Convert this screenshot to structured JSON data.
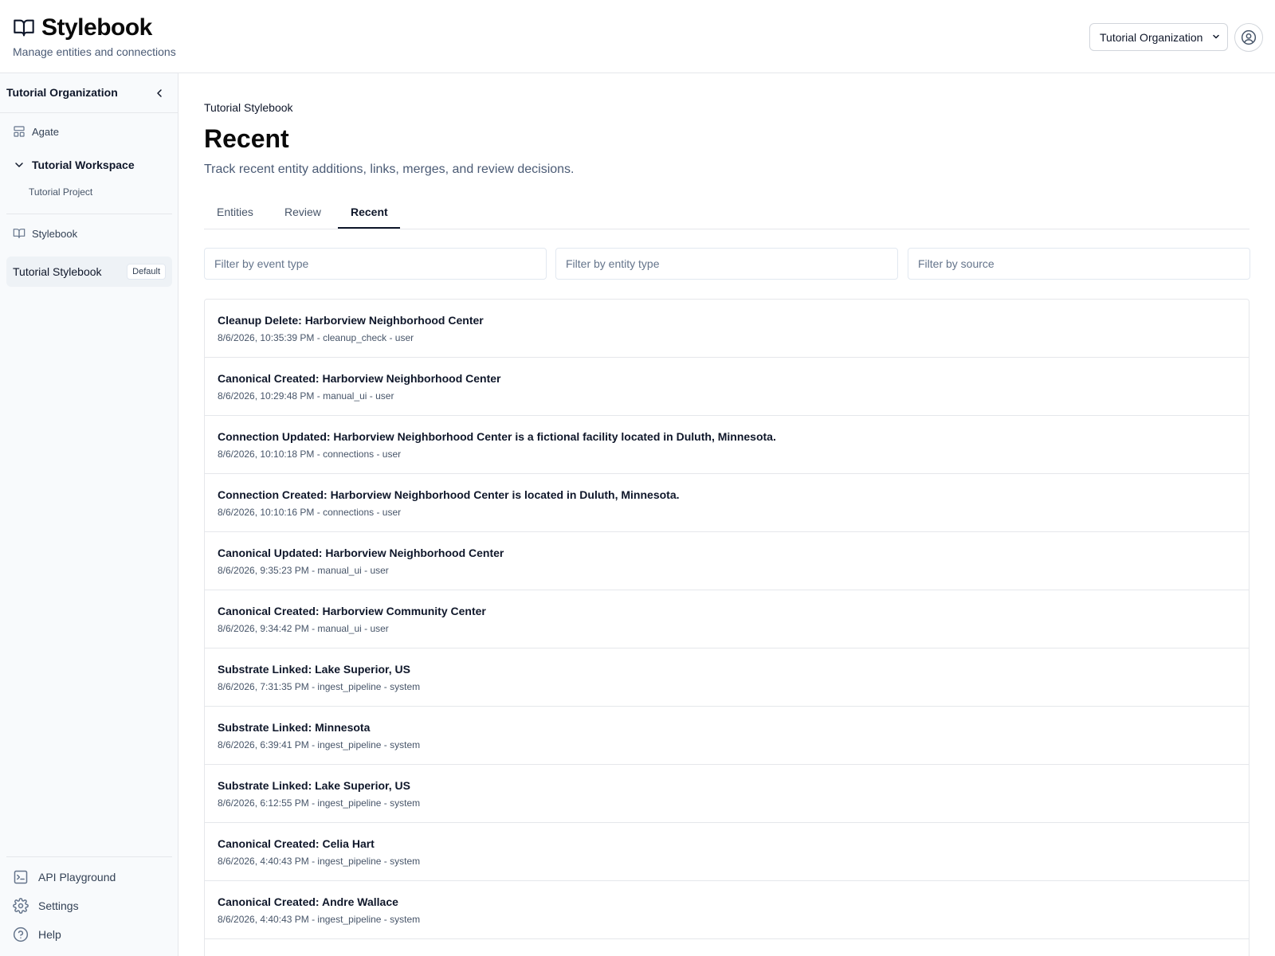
{
  "header": {
    "title": "Stylebook",
    "subtitle": "Manage entities and connections",
    "org_select": "Tutorial Organization"
  },
  "sidebar": {
    "org_name": "Tutorial Organization",
    "agate": "Agate",
    "workspace": "Tutorial Workspace",
    "project": "Tutorial Project",
    "stylebook_section": "Stylebook",
    "active_stylebook": "Tutorial Stylebook",
    "default_badge": "Default",
    "bottom": {
      "api": "API Playground",
      "settings": "Settings",
      "help": "Help"
    }
  },
  "main": {
    "breadcrumb": "Tutorial Stylebook",
    "title": "Recent",
    "description": "Track recent entity additions, links, merges, and review decisions.",
    "tabs": [
      {
        "label": "Entities"
      },
      {
        "label": "Review"
      },
      {
        "label": "Recent"
      }
    ],
    "filters": {
      "event_type": "Filter by event type",
      "entity_type": "Filter by entity type",
      "source": "Filter by source"
    },
    "events": [
      {
        "title": "Cleanup Delete: Harborview Neighborhood Center",
        "meta": "8/6/2026, 10:35:39 PM - cleanup_check - user"
      },
      {
        "title": "Canonical Created: Harborview Neighborhood Center",
        "meta": "8/6/2026, 10:29:48 PM - manual_ui - user"
      },
      {
        "title": "Connection Updated: Harborview Neighborhood Center is a fictional facility located in Duluth, Minnesota.",
        "meta": "8/6/2026, 10:10:18 PM - connections - user"
      },
      {
        "title": "Connection Created: Harborview Neighborhood Center is located in Duluth, Minnesota.",
        "meta": "8/6/2026, 10:10:16 PM - connections - user"
      },
      {
        "title": "Canonical Updated: Harborview Neighborhood Center",
        "meta": "8/6/2026, 9:35:23 PM - manual_ui - user"
      },
      {
        "title": "Canonical Created: Harborview Community Center",
        "meta": "8/6/2026, 9:34:42 PM - manual_ui - user"
      },
      {
        "title": "Substrate Linked: Lake Superior, US",
        "meta": "8/6/2026, 7:31:35 PM - ingest_pipeline - system"
      },
      {
        "title": "Substrate Linked: Minnesota",
        "meta": "8/6/2026, 6:39:41 PM - ingest_pipeline - system"
      },
      {
        "title": "Substrate Linked: Lake Superior, US",
        "meta": "8/6/2026, 6:12:55 PM - ingest_pipeline - system"
      },
      {
        "title": "Canonical Created: Celia Hart",
        "meta": "8/6/2026, 4:40:43 PM - ingest_pipeline - system"
      },
      {
        "title": "Canonical Created: Andre Wallace",
        "meta": "8/6/2026, 4:40:43 PM - ingest_pipeline - system"
      }
    ]
  }
}
